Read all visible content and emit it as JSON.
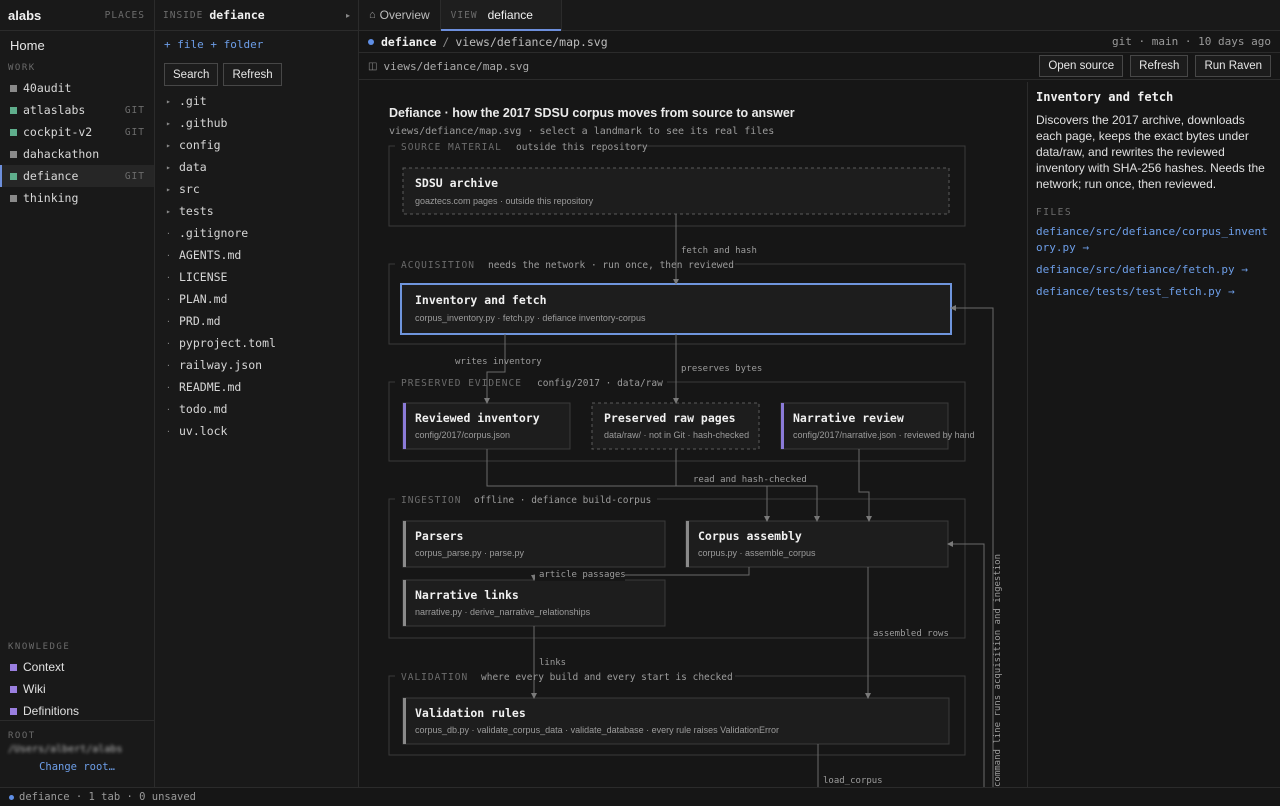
{
  "places": {
    "brand": "alabs",
    "label": "PLACES",
    "home": "Home",
    "work_label": "WORK",
    "workspaces": [
      {
        "name": "40audit",
        "tag": "",
        "color": "#8a8a8a"
      },
      {
        "name": "atlaslabs",
        "tag": "GIT",
        "color": "#5fae8c"
      },
      {
        "name": "cockpit-v2",
        "tag": "GIT",
        "color": "#5fae8c"
      },
      {
        "name": "dahackathon",
        "tag": "",
        "color": "#8a8a8a"
      },
      {
        "name": "defiance",
        "tag": "GIT",
        "color": "#5fae8c"
      },
      {
        "name": "thinking",
        "tag": "",
        "color": "#8a8a8a"
      }
    ],
    "knowledge_label": "KNOWLEDGE",
    "knowledge": [
      {
        "name": "Context",
        "color": "#9a7fe0"
      },
      {
        "name": "Wiki",
        "color": "#9a7fe0"
      },
      {
        "name": "Definitions",
        "color": "#9a7fe0"
      }
    ],
    "root_label": "ROOT",
    "root_path": "/Users/albert/alabs",
    "change_root": "Change root…"
  },
  "files": {
    "inside_label": "INSIDE",
    "inside_name": "defiance",
    "new_file": "+ file",
    "new_folder": "+ folder",
    "search": "Search",
    "refresh": "Refresh",
    "tree": [
      {
        "name": ".git",
        "folder": true
      },
      {
        "name": ".github",
        "folder": true
      },
      {
        "name": "config",
        "folder": true
      },
      {
        "name": "data",
        "folder": true
      },
      {
        "name": "src",
        "folder": true
      },
      {
        "name": "tests",
        "folder": true
      },
      {
        "name": ".gitignore",
        "folder": false
      },
      {
        "name": "AGENTS.md",
        "folder": false
      },
      {
        "name": "LICENSE",
        "folder": false
      },
      {
        "name": "PLAN.md",
        "folder": false
      },
      {
        "name": "PRD.md",
        "folder": false
      },
      {
        "name": "pyproject.toml",
        "folder": false
      },
      {
        "name": "railway.json",
        "folder": false
      },
      {
        "name": "README.md",
        "folder": false
      },
      {
        "name": "todo.md",
        "folder": false
      },
      {
        "name": "uv.lock",
        "folder": false
      }
    ]
  },
  "tabs": {
    "overview": "Overview",
    "view_label": "VIEW",
    "view_name": "defiance"
  },
  "pathbar": {
    "workspace": "defiance",
    "sep": "/",
    "path": "views/defiance/map.svg",
    "git": "git · main · 10 days ago"
  },
  "toolbar": {
    "path": "views/defiance/map.svg",
    "open_source": "Open source",
    "refresh": "Refresh",
    "run": "Run Raven"
  },
  "map": {
    "title": "Defiance · how the 2017 SDSU corpus moves from source to answer",
    "subtitle": "views/defiance/map.svg · select a landmark to see its real files",
    "sections": {
      "source": {
        "label": "SOURCE MATERIAL",
        "note": "outside this repository"
      },
      "acquisition": {
        "label": "ACQUISITION",
        "note": "needs the network · run once, then reviewed"
      },
      "preserved": {
        "label": "PRESERVED EVIDENCE",
        "note": "config/2017 · data/raw"
      },
      "ingestion": {
        "label": "INGESTION",
        "note": "offline · defiance build-corpus"
      },
      "validation": {
        "label": "VALIDATION",
        "note": "where every build and every start is checked"
      }
    },
    "nodes": {
      "archive": {
        "title": "SDSU archive",
        "sub": "goaztecs.com pages · outside this repository"
      },
      "inventory": {
        "title": "Inventory and fetch",
        "sub": "corpus_inventory.py · fetch.py · defiance inventory-corpus"
      },
      "reviewed": {
        "title": "Reviewed inventory",
        "sub": "config/2017/corpus.json"
      },
      "raw": {
        "title": "Preserved raw pages",
        "sub": "data/raw/ · not in Git · hash-checked"
      },
      "narrative": {
        "title": "Narrative review",
        "sub": "config/2017/narrative.json · reviewed by hand"
      },
      "parsers": {
        "title": "Parsers",
        "sub": "corpus_parse.py · parse.py"
      },
      "assembly": {
        "title": "Corpus assembly",
        "sub": "corpus.py · assemble_corpus"
      },
      "links": {
        "title": "Narrative links",
        "sub": "narrative.py · derive_narrative_relationships"
      },
      "rules": {
        "title": "Validation rules",
        "sub": "corpus_db.py · validate_corpus_data · validate_database · every rule raises ValidationError"
      }
    },
    "edges": {
      "fetch": "fetch and hash",
      "writes": "writes inventory",
      "preserves": "preserves bytes",
      "read": "read and hash-checked",
      "article": "article passages",
      "assembled": "assembled rows",
      "links": "links",
      "load": "load_corpus",
      "command": "command line runs acquisition and ingestion"
    }
  },
  "detail": {
    "title": "Inventory and fetch",
    "description": "Discovers the 2017 archive, downloads each page, keeps the exact bytes under data/raw, and rewrites the reviewed inventory with SHA-256 hashes. Needs the network; run once, then reviewed.",
    "files_label": "FILES",
    "files": [
      "defiance/src/defiance/corpus_inventory.py →",
      "defiance/src/defiance/fetch.py →",
      "defiance/tests/test_fetch.py →"
    ]
  },
  "status": {
    "text": "defiance · 1 tab · 0 unsaved"
  },
  "colors": {
    "accent": "#6d8fdc",
    "link": "#6d9ee8",
    "git": "#5fae8c",
    "knowledge": "#9a7fe0",
    "node_bar_purple": "#8b7bd8",
    "node_bar_gray": "#8a8a8a"
  }
}
